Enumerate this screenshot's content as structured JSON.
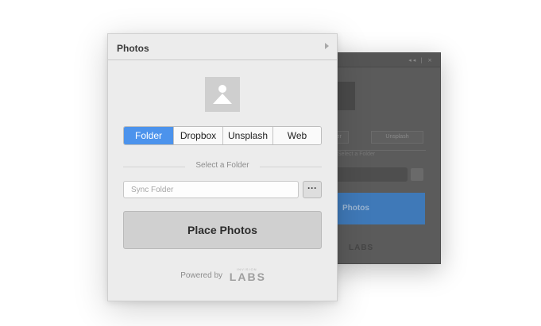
{
  "back_panel": {
    "window_controls": "◂◂ | ×",
    "tab_left": "older",
    "tab_right": "Unsplash",
    "sub_label": "Select a Folder",
    "button_label": "Photos",
    "logo_text": "LABS"
  },
  "panel": {
    "title": "Photos",
    "tabs": [
      {
        "label": "Folder",
        "active": true
      },
      {
        "label": "Dropbox",
        "active": false
      },
      {
        "label": "Unsplash",
        "active": false
      },
      {
        "label": "Web",
        "active": false
      }
    ],
    "section_label": "Select a Folder",
    "sync_placeholder": "Sync Folder",
    "sync_value": "",
    "browse_label": "···",
    "place_button": "Place Photos",
    "powered_by": "Powered by",
    "logo_small": "INVISION",
    "logo_main": "LABS"
  },
  "colors": {
    "accent": "#4c93ec",
    "panel_bg": "#ececec",
    "back_panel_bg": "#5b5b5b",
    "back_accent": "#3f79b8"
  },
  "icons": {
    "thumbnail": "image-placeholder-icon",
    "expand": "chevron-right-icon"
  }
}
